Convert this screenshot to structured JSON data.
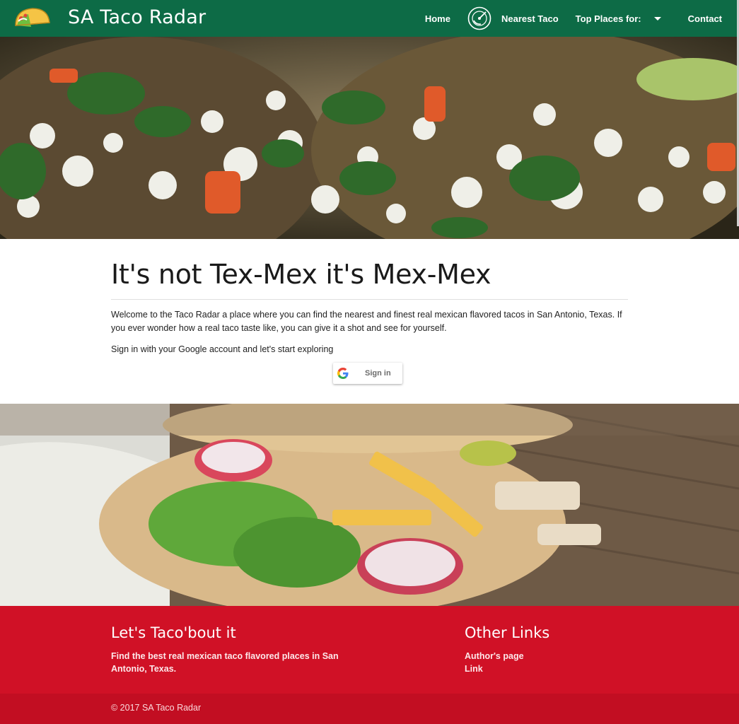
{
  "nav": {
    "brand": "SA Taco Radar",
    "home": "Home",
    "nearest": "Nearest Taco",
    "top_places": "Top Places for:",
    "contact": "Contact"
  },
  "main": {
    "headline": "It's not Tex-Mex it's Mex-Mex",
    "welcome": "Welcome to the Taco Radar a place where you can find the nearest and finest real mexican flavored tacos in San Antonio, Texas. If you ever wonder how a real taco taste like, you can give it a shot and see for yourself.",
    "signin_prompt": "Sign in with your Google account and let's start exploring",
    "signin_button": "Sign in"
  },
  "footer": {
    "title": "Let's Taco'bout it",
    "tagline": "Find the best real mexican taco flavored places in San Antonio, Texas.",
    "links_title": "Other Links",
    "links": [
      "Author's page",
      "Link"
    ],
    "copyright": "© 2017 SA Taco Radar"
  },
  "colors": {
    "nav_bg": "#0d6b46",
    "footer_bg": "#d01126",
    "copyright_bg": "#c20e22"
  },
  "icons": [
    "taco-logo-icon",
    "radar-icon",
    "chevron-down-icon",
    "google-g-icon"
  ]
}
